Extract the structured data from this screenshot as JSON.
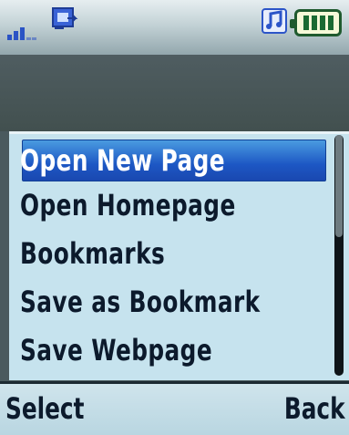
{
  "status_bar": {
    "signal_icon": "signal-strength-icon",
    "network_icon": "data-connection-icon",
    "music_icon": "music-note-icon",
    "battery_icon": "battery-icon",
    "accent_color": "#2a53c5"
  },
  "menu": {
    "items": [
      {
        "label": "Open New Page",
        "selected": true
      },
      {
        "label": "Open Homepage",
        "selected": false
      },
      {
        "label": "Bookmarks",
        "selected": false
      },
      {
        "label": "Save as Bookmark",
        "selected": false
      },
      {
        "label": "Save Webpage",
        "selected": false
      }
    ],
    "highlight_color": "#1d57c4",
    "background_color": "#c6e3ee"
  },
  "softkeys": {
    "left_label": "Select",
    "right_label": "Back"
  }
}
